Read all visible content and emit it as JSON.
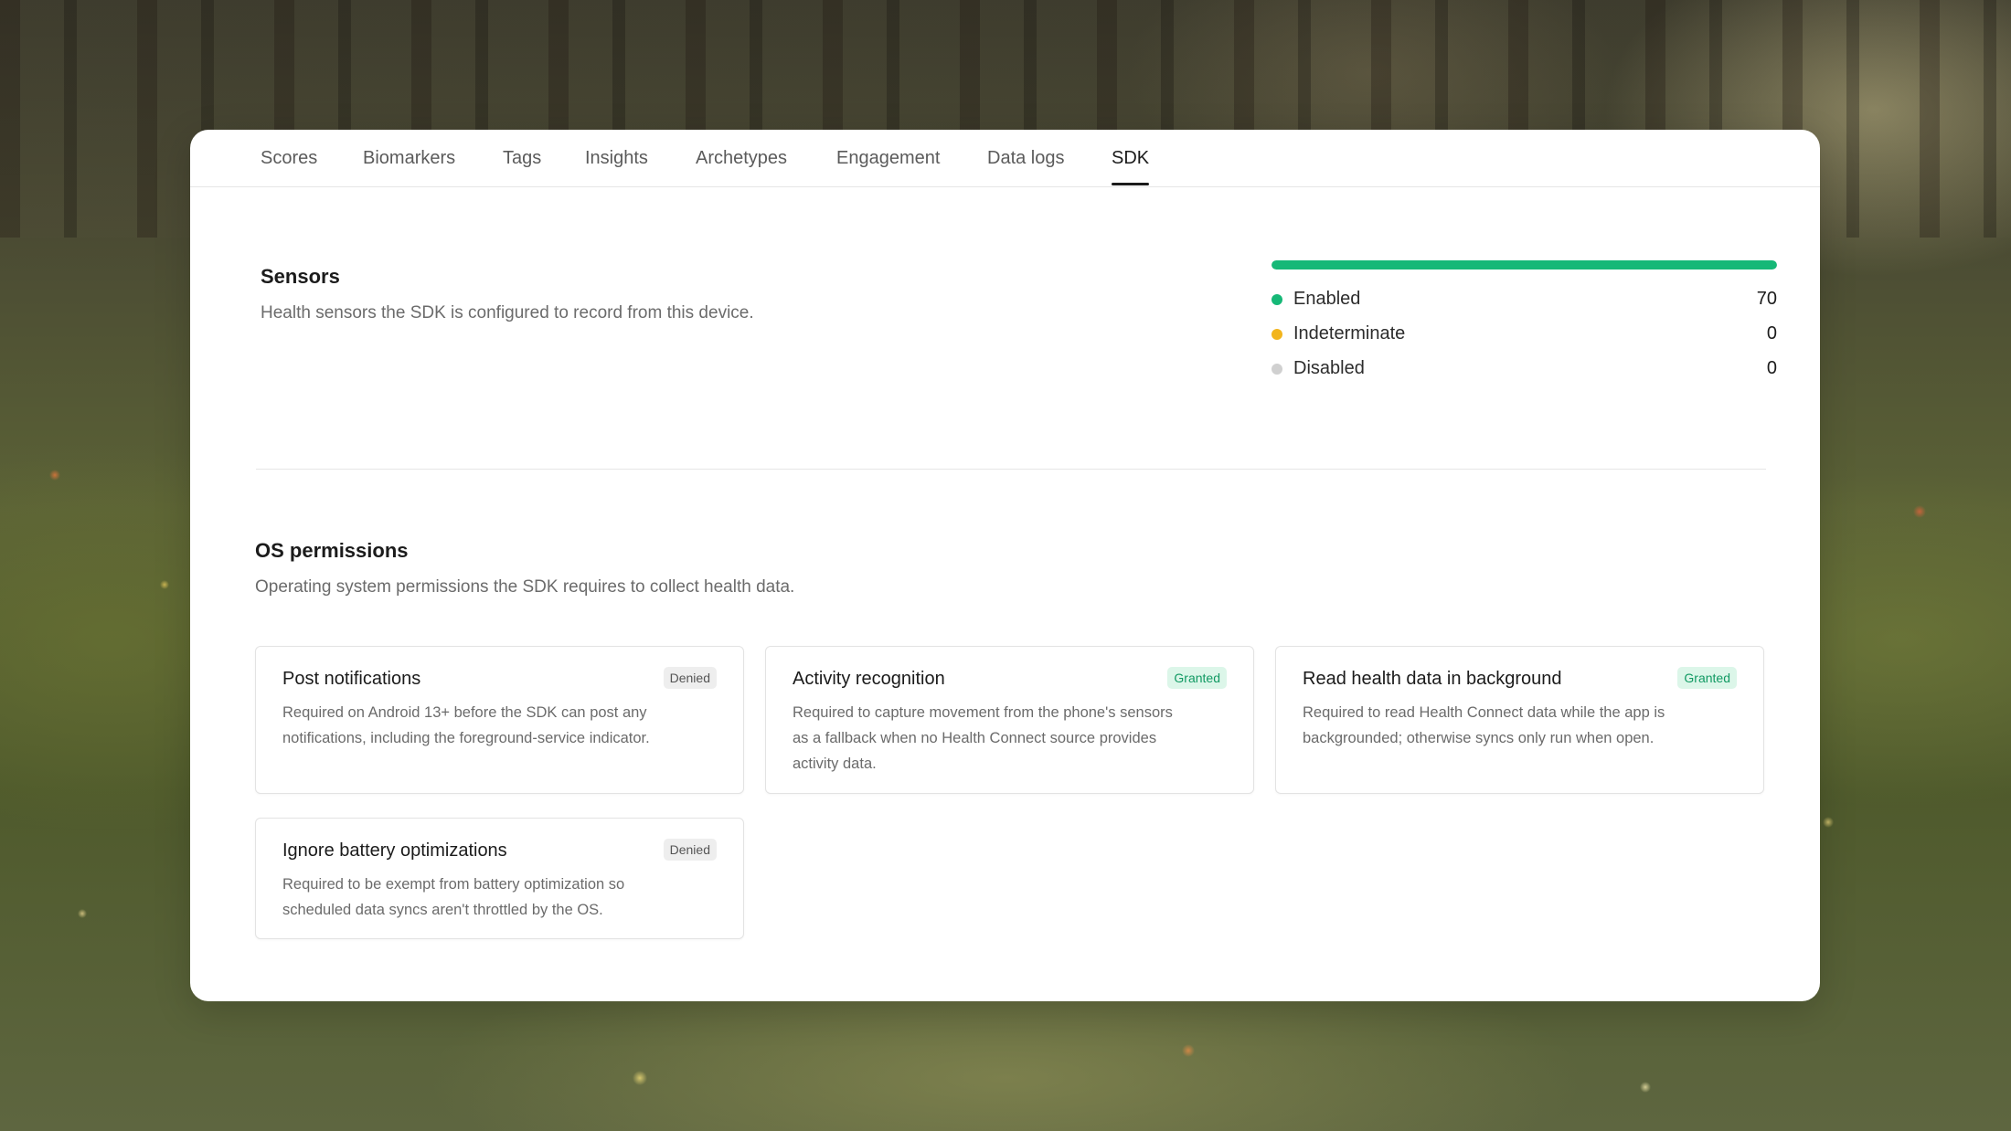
{
  "tabs": [
    {
      "label": "Scores"
    },
    {
      "label": "Biomarkers"
    },
    {
      "label": "Tags"
    },
    {
      "label": "Insights"
    },
    {
      "label": "Archetypes"
    },
    {
      "label": "Engagement"
    },
    {
      "label": "Data logs"
    },
    {
      "label": "SDK",
      "active": true
    }
  ],
  "sensors": {
    "title": "Sensors",
    "description": "Health sensors the SDK is configured to record from this device.",
    "progress_enabled_fraction": 1.0,
    "legend": [
      {
        "label": "Enabled",
        "value": "70",
        "color": "#16b877"
      },
      {
        "label": "Indeterminate",
        "value": "0",
        "color": "#f2b51d"
      },
      {
        "label": "Disabled",
        "value": "0",
        "color": "#d0d0d0"
      }
    ]
  },
  "permissions": {
    "title": "OS permissions",
    "description": "Operating system permissions the SDK requires to collect health data.",
    "cards": [
      {
        "title": "Post notifications",
        "status": "Denied",
        "description": "Required on Android 13+ before the SDK can post any notifications, including the foreground-service indicator."
      },
      {
        "title": "Activity recognition",
        "status": "Granted",
        "description": "Required to capture movement from the phone's sensors as a fallback when no Health Connect source provides activity data."
      },
      {
        "title": "Read health data in background",
        "status": "Granted",
        "description": "Required to read Health Connect data while the app is backgrounded; otherwise syncs only run when open."
      },
      {
        "title": "Ignore battery optimizations",
        "status": "Denied",
        "description": "Required to be exempt from battery optimization so scheduled data syncs aren't throttled by the OS."
      }
    ]
  },
  "colors": {
    "accent_green": "#16b877",
    "granted_badge_bg": "#dcf6e9",
    "granted_badge_text": "#119a63",
    "denied_badge_bg": "#eeeeee"
  }
}
